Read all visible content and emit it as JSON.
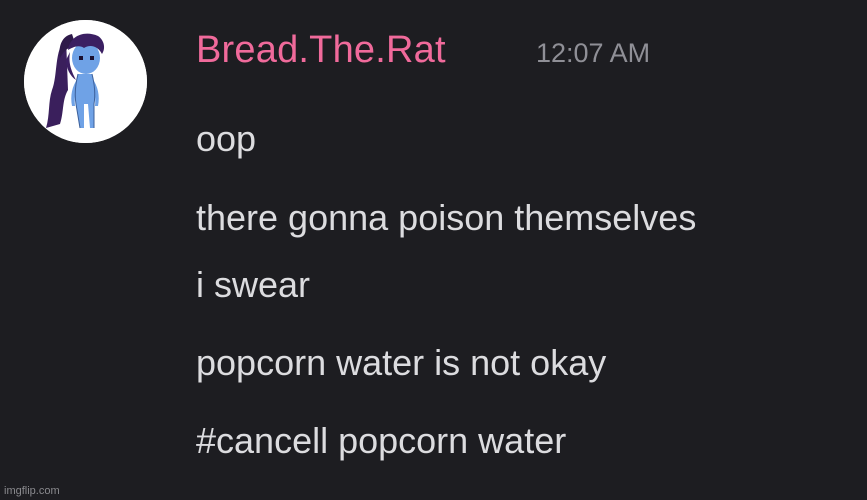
{
  "message": {
    "avatar_icon": "user-avatar-icon",
    "username": "Bread.The.Rat",
    "username_color": "#f06a9b",
    "timestamp": "12:07 AM",
    "lines": [
      "oop",
      "there gonna poison themselves",
      "i swear",
      "popcorn water is not okay",
      "#cancell popcorn water"
    ]
  },
  "watermark": "imgflip.com"
}
